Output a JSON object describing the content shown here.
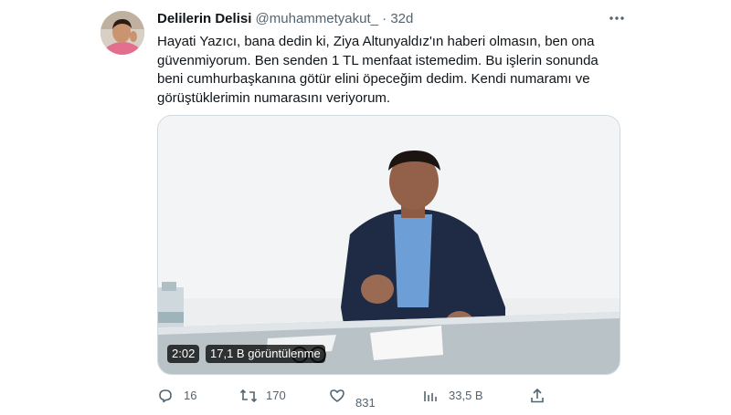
{
  "tweet": {
    "display_name": "Delilerin Delisi",
    "handle": "@muhammetyakut_",
    "separator": "·",
    "time": "32d",
    "more_icon": "more-icon",
    "text": "Hayati Yazıcı, bana dedin ki, Ziya Altunyaldız'ın haberi olmasın, ben ona güvenmiyorum. Ben senden 1 TL menfaat istemedim. Bu işlerin sonunda beni cumhurbaşkanına götür elini öpeceğim dedim. Kendi numaramı ve görüştüklerimin numarasını veriyorum.",
    "media": {
      "duration": "2:02",
      "views_label": "17,1 B görüntülenme"
    },
    "actions": {
      "replies": "16",
      "retweets": "170",
      "likes": "831",
      "views": "33,5 B"
    }
  }
}
